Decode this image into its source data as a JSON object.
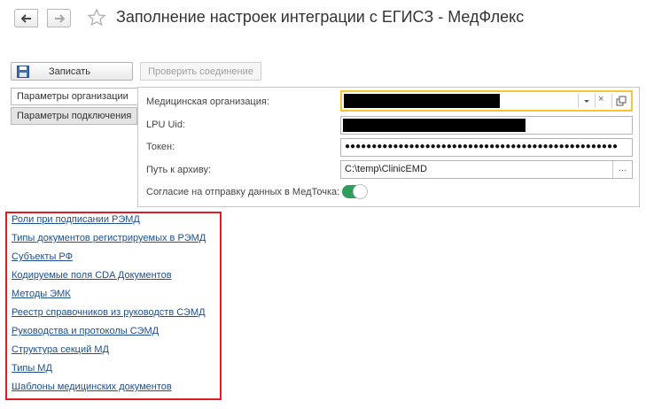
{
  "window": {
    "title": "Заполнение настроек интеграции с ЕГИСЗ - МедФлекс"
  },
  "toolbar": {
    "save_label": "Записать",
    "check_label": "Проверить соединение"
  },
  "tabs": [
    {
      "label": "Параметры организации",
      "active": true
    },
    {
      "label": "Параметры подключения",
      "active": false
    }
  ],
  "form": {
    "org_label": "Медицинская организация:",
    "org_value": "",
    "lpu_label": "LPU Uid:",
    "lpu_value": "",
    "token_label": "Токен:",
    "token_value": "●●●●●●●●●●●●●●●●●●●●●●●●●●●●●●●●●●●●●●●●●●●●●●●●●●●",
    "path_label": "Путь к архиву:",
    "path_value": "C:\\temp\\ClinicEMD",
    "path_btn": "...",
    "consent_label": "Согласие на отправку данных в МедТочка:",
    "consent_on": true
  },
  "links": [
    "Роли при подписании РЭМД",
    "Типы документов регистрируемых в РЭМД",
    "Субъекты РФ",
    "Кодируемые поля CDA Документов",
    "Методы ЭМК",
    "Реестр справочников из руководств СЭМД",
    "Руководства и протоколы СЭМД",
    "Структура секций МД",
    "Типы МД",
    "Шаблоны медицинских документов"
  ],
  "colors": {
    "highlight_border": "#e01c24",
    "focus_border": "#f5c535",
    "toggle_on": "#2f9e5b",
    "link": "#1d4f8c"
  }
}
